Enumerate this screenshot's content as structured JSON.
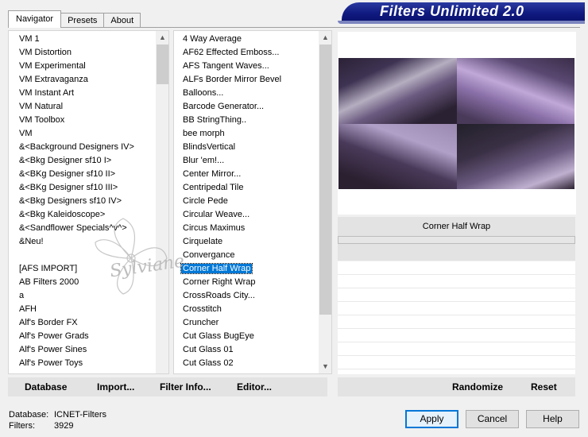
{
  "banner": {
    "title": "Filters Unlimited 2.0"
  },
  "tabs": [
    {
      "label": "Navigator",
      "active": true
    },
    {
      "label": "Presets",
      "active": false
    },
    {
      "label": "About",
      "active": false
    }
  ],
  "categories": [
    "VM 1",
    "VM Distortion",
    "VM Experimental",
    "VM Extravaganza",
    "VM Instant Art",
    "VM Natural",
    "VM Toolbox",
    "VM",
    "&<Background Designers IV>",
    "&<Bkg Designer sf10 I>",
    "&<BKg Designer sf10 II>",
    "&<BKg Designer sf10 III>",
    "&<Bkg Designers sf10 IV>",
    "&<Bkg Kaleidoscope>",
    "&<Sandflower Specials^v^>",
    "&Neu!",
    "",
    "[AFS IMPORT]",
    "AB Filters 2000",
    "a",
    "AFH",
    "Alf's Border FX",
    "Alf's Power Grads",
    "Alf's Power Sines",
    "Alf's Power Toys"
  ],
  "filters": [
    "4 Way Average",
    "AF62 Effected Emboss...",
    "AFS Tangent Waves...",
    "ALFs Border Mirror Bevel",
    "Balloons...",
    "Barcode Generator...",
    "BB StringThing..",
    "bee morph",
    "BlindsVertical",
    "Blur 'em!...",
    "Center Mirror...",
    "Centripedal Tile",
    "Circle Pede",
    "Circular Weave...",
    "Circus Maximus",
    "Cirquelate",
    "Convergance",
    "Corner Half Wrap",
    "Corner Right Wrap",
    "CrossRoads City...",
    "Crosstitch",
    "Cruncher",
    "Cut Glass  BugEye",
    "Cut Glass 01",
    "Cut Glass 02"
  ],
  "selected_filter_index": 17,
  "preview": {
    "filter_name": "Corner Half Wrap"
  },
  "toolbar": {
    "database": "Database",
    "import": "Import...",
    "filter_info": "Filter Info...",
    "editor": "Editor...",
    "randomize": "Randomize",
    "reset": "Reset"
  },
  "footer": {
    "database_label": "Database:",
    "database_value": "ICNET-Filters",
    "filters_label": "Filters:",
    "filters_value": "3929",
    "apply": "Apply",
    "cancel": "Cancel",
    "help": "Help"
  },
  "watermark": {
    "text": "Sylviane"
  },
  "colors": {
    "banner": "#101a80",
    "selection": "#0078d7",
    "accent": "#0078d7"
  },
  "icons": [
    "scroll-up-icon",
    "scroll-down-icon"
  ]
}
